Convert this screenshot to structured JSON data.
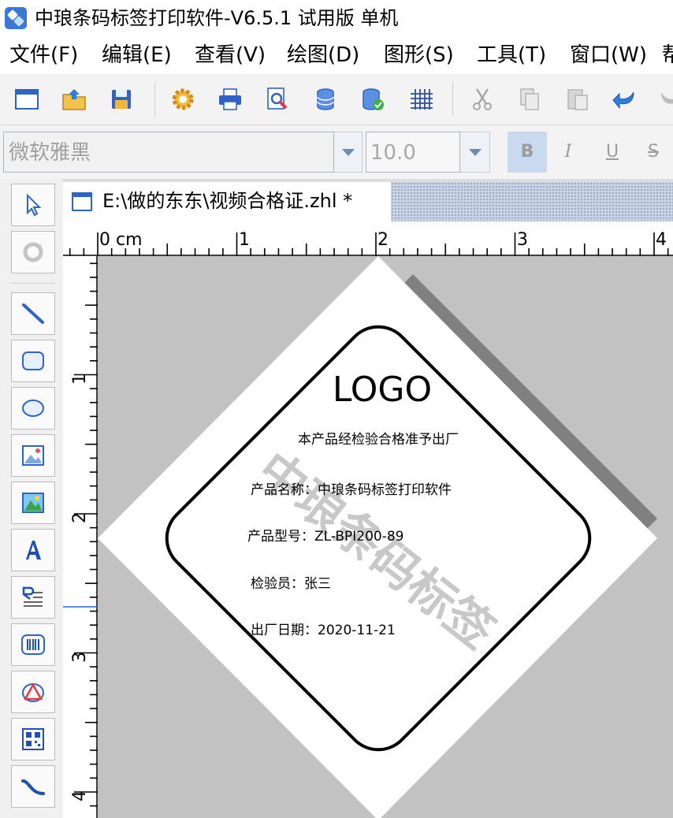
{
  "window": {
    "title": "中琅条码标签打印软件-V6.5.1 试用版 单机"
  },
  "menu": {
    "items": [
      {
        "label": "文件(F)"
      },
      {
        "label": "编辑(E)"
      },
      {
        "label": "查看(V)"
      },
      {
        "label": "绘图(D)"
      },
      {
        "label": "图形(S)"
      },
      {
        "label": "工具(T)"
      },
      {
        "label": "窗口(W)"
      },
      {
        "label": "帮"
      }
    ]
  },
  "toolbar": {
    "buttons": [
      "new-document-icon",
      "open-folder-icon",
      "save-icon",
      "settings-gear-icon",
      "print-icon",
      "print-preview-icon",
      "database-icon",
      "database-settings-icon",
      "grid-icon",
      "cut-icon",
      "copy-icon",
      "paste-icon",
      "undo-icon",
      "redo-icon"
    ]
  },
  "format": {
    "font_name": "微软雅黑",
    "font_size": "10.0",
    "bold": "B",
    "italic": "I",
    "underline": "U",
    "strike": "S"
  },
  "tools": [
    "select-arrow-icon",
    "rotate-icon",
    "line-icon",
    "rounded-rect-icon",
    "ellipse-icon",
    "image-icon",
    "color-image-icon",
    "text-icon",
    "rich-text-icon",
    "barcode-icon",
    "shape-icon",
    "qrcode-icon",
    "curve-icon"
  ],
  "document": {
    "tab_label": "E:\\做的东东\\视频合格证.zhl *"
  },
  "ruler": {
    "unit": "cm",
    "top_labels": [
      "0 cm",
      "1",
      "2",
      "3",
      "4"
    ],
    "left_labels": [
      "1",
      "2",
      "3",
      "4"
    ]
  },
  "label": {
    "logo_text": "LOGO",
    "subtitle": "本产品经检验合格准予出厂",
    "product_name": "产品名称：中琅条码标签打印软件",
    "product_model": "产品型号：ZL-BPI200-89",
    "inspector": "检验员：张三",
    "date": "出厂日期：2020-11-21",
    "watermark": "中琅条码标签"
  },
  "colors": {
    "accent_blue": "#2f64c6",
    "paper_shadow": "#808080",
    "canvas_bg": "#c2c2c2",
    "bold_active": "#c9d9ee"
  }
}
